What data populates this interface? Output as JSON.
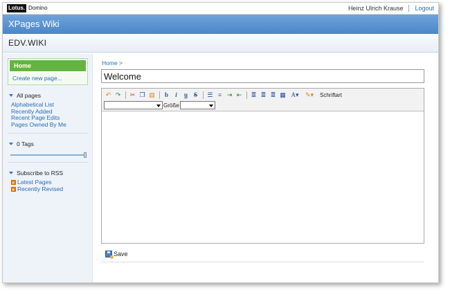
{
  "topbar": {
    "logo_lotus": "Lotus.",
    "logo_domino": "Domino",
    "user_name": "Heinz Ulrich Krause",
    "logout_label": "Logout"
  },
  "app": {
    "title": "XPages Wiki",
    "database": "EDV.WIKI"
  },
  "sidebar": {
    "home_label": "Home",
    "create_label": "Create new page...",
    "all_pages": {
      "heading": "All pages",
      "links": [
        "Alphabetical List",
        "Recently Added",
        "Recent Page Edits",
        "Pages Owned By Me"
      ]
    },
    "tags": {
      "heading": "0 Tags"
    },
    "rss": {
      "heading": "Subscribe to RSS",
      "links": [
        "Latest Pages",
        "Recently Revised"
      ]
    }
  },
  "main": {
    "breadcrumb": "Home >",
    "title_value": "Welcome",
    "editor": {
      "font_label": "Schriftart",
      "size_label": "Größe",
      "font_value": "",
      "size_value": ""
    },
    "save_label": "Save"
  },
  "colors": {
    "accent_blue": "#4b86c9",
    "nav_green": "#66b344",
    "link_blue": "#2a6db0"
  }
}
